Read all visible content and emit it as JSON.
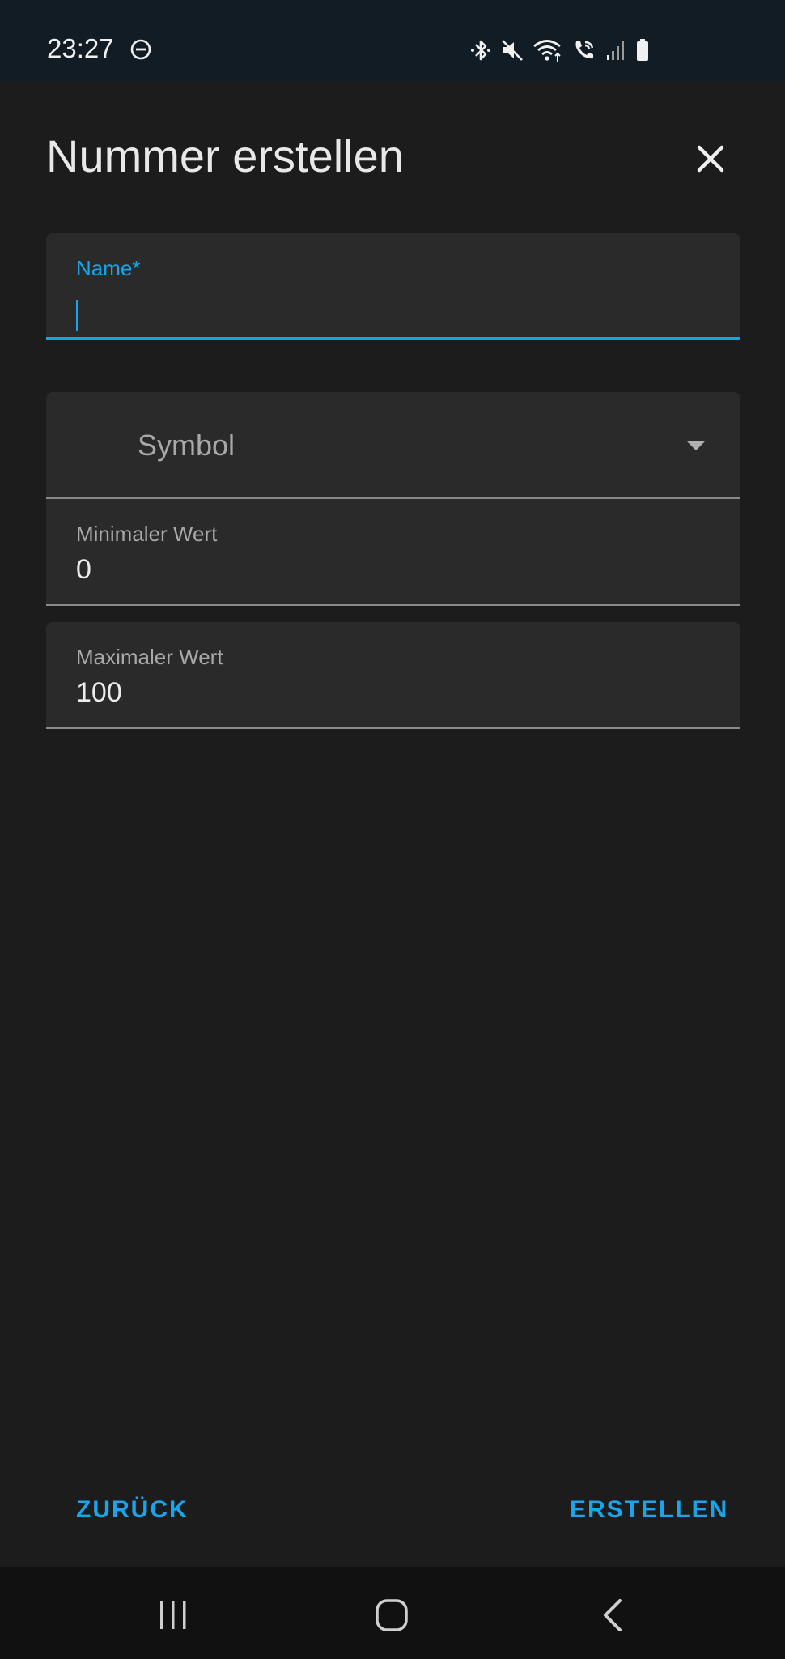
{
  "status_bar": {
    "time": "23:27",
    "icons": [
      "do-not-disturb-icon",
      "bluetooth-icon",
      "mute-icon",
      "wifi-icon",
      "wifi-calling-icon",
      "signal-icon",
      "battery-icon"
    ]
  },
  "dialog": {
    "title": "Nummer erstellen",
    "fields": {
      "name": {
        "label": "Name*",
        "value": ""
      },
      "symbol": {
        "placeholder": "Symbol"
      },
      "min": {
        "label": "Minimaler Wert",
        "value": "0"
      },
      "max": {
        "label": "Maximaler Wert",
        "value": "100"
      }
    },
    "buttons": {
      "back": "ZURÜCK",
      "create": "ERSTELLEN"
    }
  },
  "colors": {
    "accent": "#19a4ec",
    "background": "#1c1c1c",
    "field_bg": "#2a2a2a",
    "status_bar_bg": "#111c24"
  }
}
